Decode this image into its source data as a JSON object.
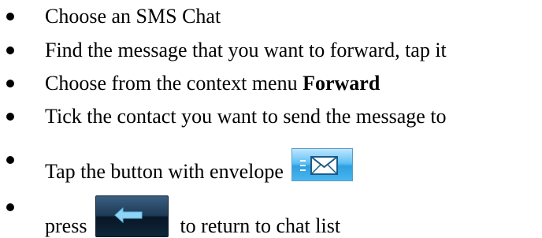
{
  "instructions": {
    "items": [
      {
        "text": "Choose an SMS Chat"
      },
      {
        "text": "Find the message that you want to forward, tap it"
      },
      {
        "text": "Choose from the context menu ",
        "bold": "Forward"
      },
      {
        "text": "Tick the contact you want to send the message to"
      },
      {
        "text": "Tap the button with envelope",
        "icon": "envelope-icon"
      },
      {
        "text_before": "press",
        "icon": "back-arrow-icon",
        "text_after": "to return to chat list"
      }
    ]
  },
  "colors": {
    "envelope_button": "#49b6ee",
    "back_button": "#1e3a55",
    "back_arrow": "#8fd3f5"
  }
}
